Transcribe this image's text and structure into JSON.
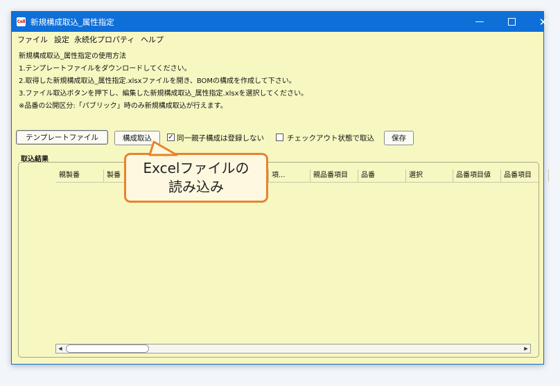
{
  "window": {
    "app_icon_label": "Cell",
    "title": "新規構成取込_属性指定",
    "minimize_glyph": "—",
    "close_glyph": "✕"
  },
  "menu": {
    "items": [
      "ファイル",
      "設定",
      "永続化プロパティ",
      "ヘルプ"
    ]
  },
  "instructions": {
    "heading": "新規構成取込_属性指定の使用方法",
    "lines": [
      "1.テンプレートファイルをダウンロードしてください。",
      "2.取得した新規構成取込_属性指定.xlsxファイルを開き、BOMの構成を作成して下さい。",
      "3.ファイル取込ボタンを押下し、編集した新規構成取込_属性指定.xlsxを選択してください。",
      "※品番の公開区分:「パブリック」時のみ新規構成取込が行えます。"
    ]
  },
  "toolbar": {
    "template_button": "テンプレートファイル",
    "import_button": "構成取込",
    "checkbox1": {
      "label": "同一親子構成は登録しない",
      "checked": true,
      "glyph": "✓"
    },
    "checkbox2": {
      "label": "チェックアウト状態で取込",
      "checked": false
    },
    "save_button": "保存"
  },
  "results": {
    "label": "取込結果",
    "columns": [
      "親製番",
      "製番",
      "",
      "",
      "",
      "項...",
      "親品番項目",
      "品番",
      "選択",
      "品番項目値",
      "品番項目"
    ]
  },
  "scrollbar": {
    "left_arrow": "◀",
    "right_arrow": "▶"
  },
  "callout": {
    "line1": "Excelファイルの",
    "line2": "読み込み"
  },
  "colors": {
    "titlebar": "#0f6fd8",
    "window_bg": "#f7f7c2",
    "callout_border": "#e7832f",
    "callout_bg": "#fdf8df"
  }
}
